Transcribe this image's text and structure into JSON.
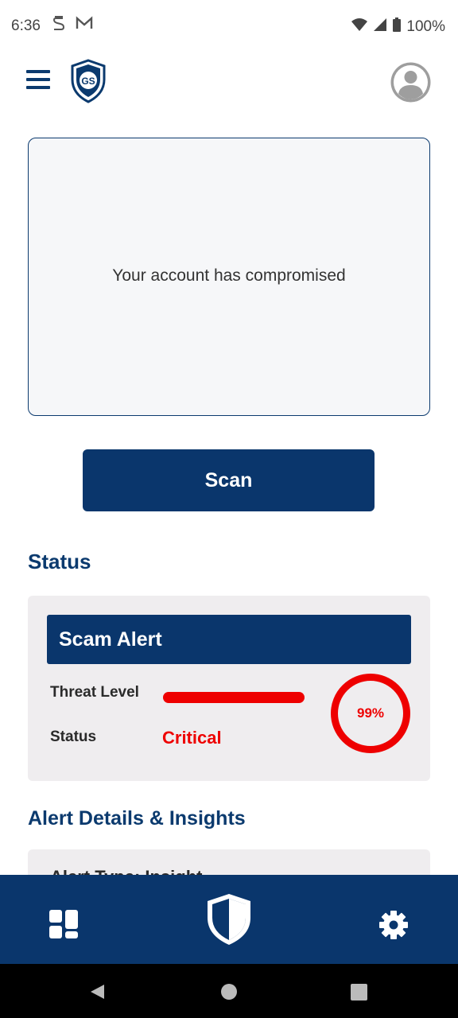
{
  "status_bar": {
    "time": "6:36",
    "notification_icons": [
      "s-sync-icon",
      "gmail-icon"
    ],
    "battery_text": "100%"
  },
  "header": {
    "logo_text": "GS"
  },
  "message_box": {
    "text": "Your account has compromised"
  },
  "scan_button_label": "Scan",
  "status_section": {
    "title": "Status",
    "alert_title": "Scam Alert",
    "threat_level_label": "Threat Level",
    "threat_level_fraction": 1.0,
    "status_label": "Status",
    "status_value": "Critical",
    "gauge_text": "99%",
    "gauge_value": 99
  },
  "details_section": {
    "title": "Alert Details & Insights",
    "card_title": "Alert Type: Insight"
  },
  "bottom_nav": {
    "items": [
      "dashboard-icon",
      "shield-icon",
      "settings-icon"
    ]
  },
  "colors": {
    "primary": "#0a366c",
    "danger": "#ee0000",
    "card_bg": "#efedef"
  }
}
